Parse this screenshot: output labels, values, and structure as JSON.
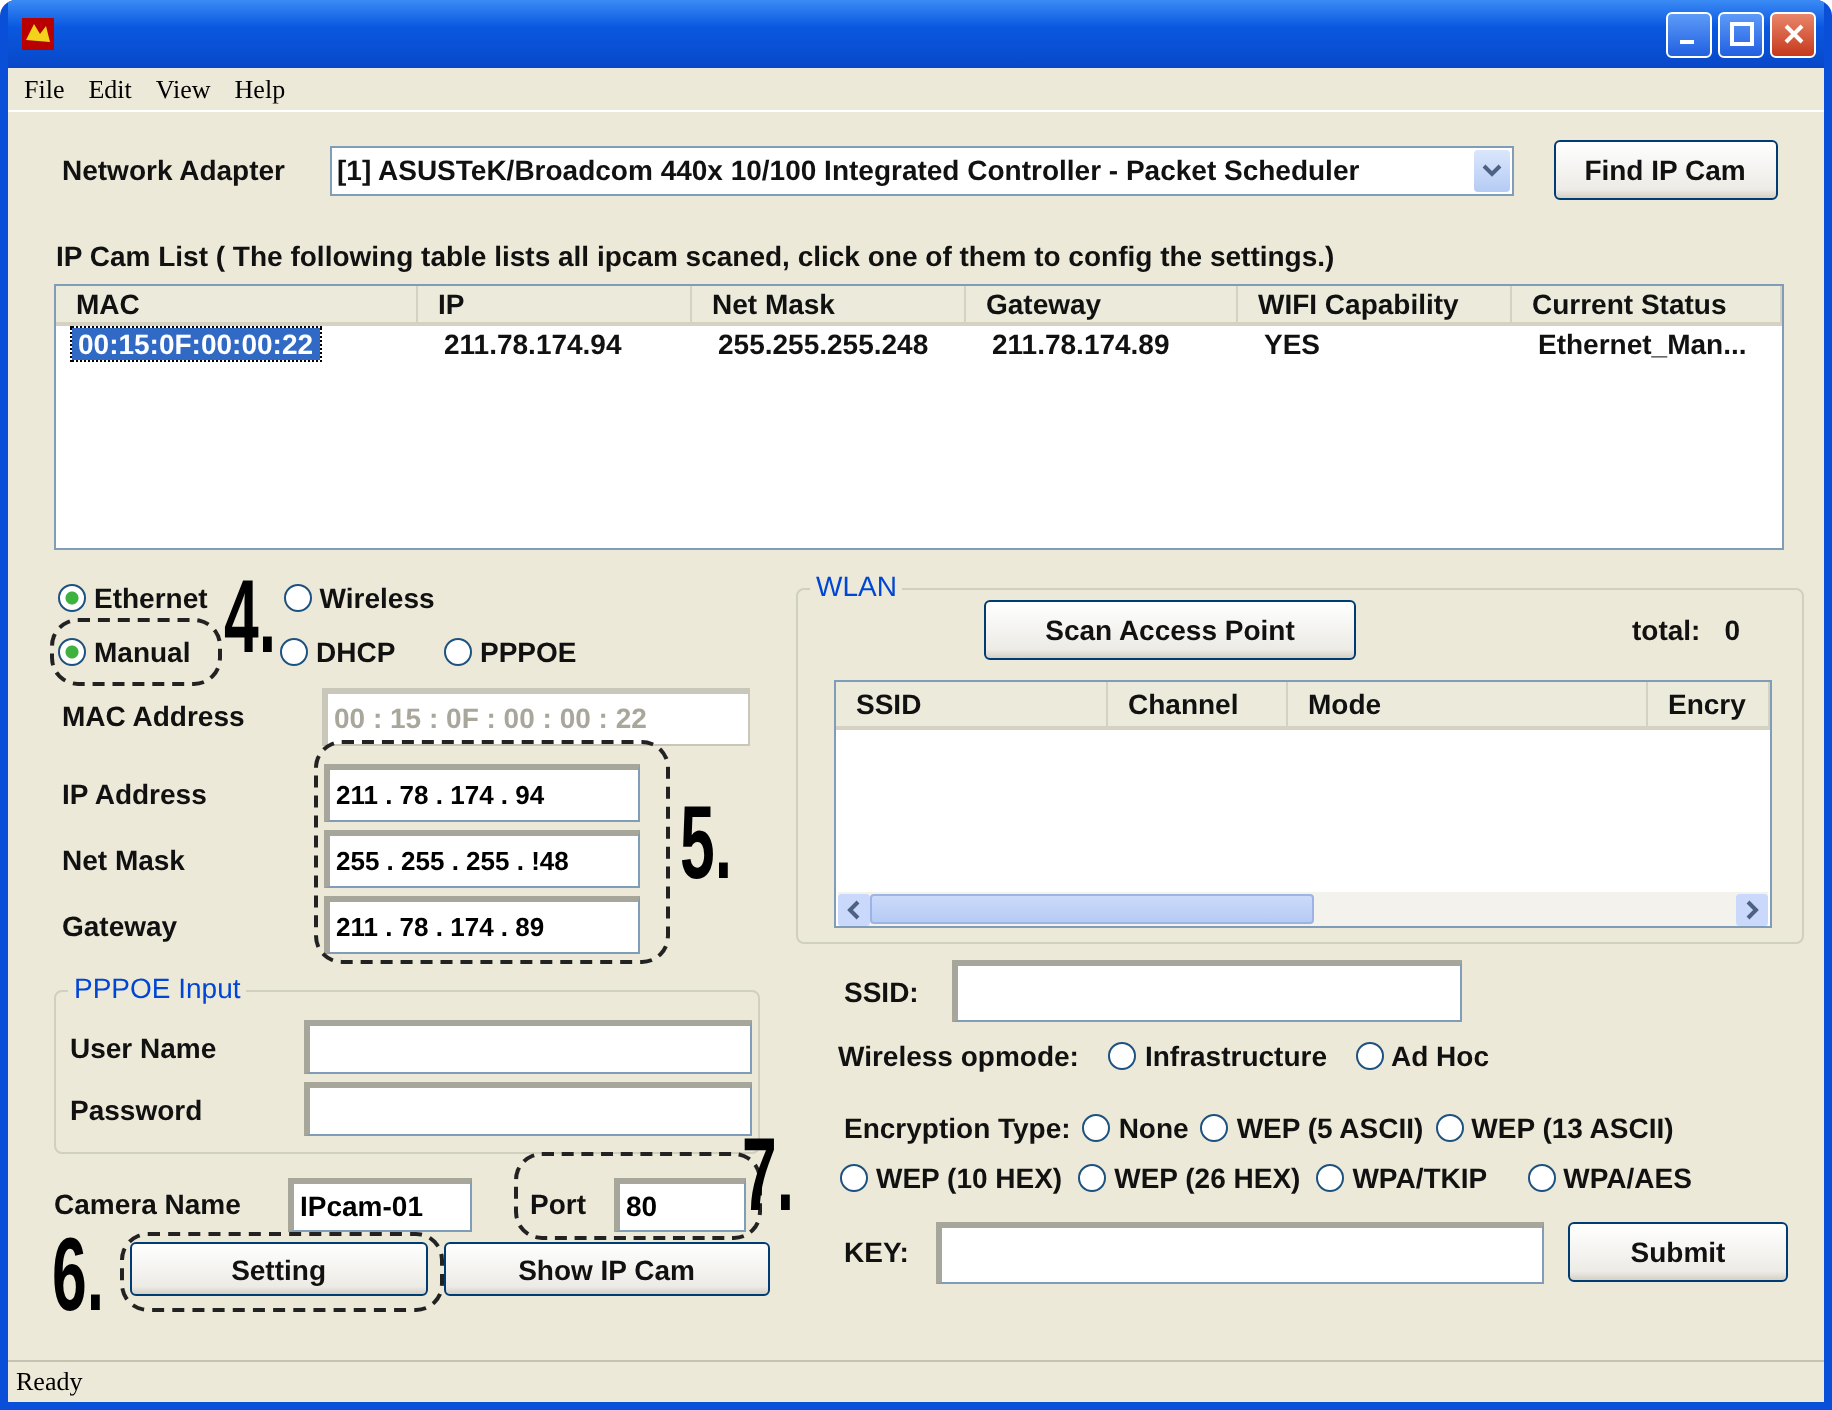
{
  "menu": [
    {
      "label": "File"
    },
    {
      "label": "Edit"
    },
    {
      "label": "View"
    },
    {
      "label": "Help"
    }
  ],
  "adapter": {
    "label": "Network Adapter",
    "value": "[1] ASUSTeK/Broadcom 440x 10/100 Integrated Controller - Packet Scheduler",
    "button": "Find IP Cam"
  },
  "ipcam_list": {
    "caption": "IP Cam List  ( The following table lists all ipcam scaned, click one of them to config the settings.)",
    "columns": [
      "MAC",
      "IP",
      "Net Mask",
      "Gateway",
      "WIFI Capability",
      "Current Status"
    ],
    "rows": [
      {
        "selected": true,
        "cells": [
          "00:15:0F:00:00:22",
          "211.78.174.94",
          "255.255.255.248",
          "211.78.174.89",
          "YES",
          "Ethernet_Man..."
        ]
      }
    ]
  },
  "connection": [
    {
      "label": "Ethernet",
      "selected": true
    },
    {
      "label": "Wireless",
      "selected": false
    }
  ],
  "ip_mode": [
    {
      "label": "Manual",
      "selected": true
    },
    {
      "label": "DHCP",
      "selected": false
    },
    {
      "label": "PPPOE",
      "selected": false
    }
  ],
  "address_fields": [
    {
      "label": "MAC Address",
      "value": "00 : 15 : 0F : 00 : 00 : 22",
      "disabled": true
    },
    {
      "label": "IP Address",
      "value": "211 . 78 . 174 . 94",
      "disabled": false
    },
    {
      "label": "Net Mask",
      "value": "255 . 255 . 255 . !48",
      "disabled": false
    },
    {
      "label": "Gateway",
      "value": "211 . 78 . 174 . 89",
      "disabled": false
    }
  ],
  "pppoe": {
    "title": "PPPOE Input",
    "fields": [
      {
        "label": "User Name"
      },
      {
        "label": "Password"
      }
    ]
  },
  "camera_name": {
    "label": "Camera Name",
    "value": "IPcam-01"
  },
  "port": {
    "label": "Port",
    "value": "80"
  },
  "buttons": [
    "Setting",
    "Show IP Cam"
  ],
  "wlan": {
    "title": "WLAN",
    "scan_button": "Scan Access Point",
    "total_label": "total:",
    "total": "0",
    "columns": [
      "SSID",
      "Channel",
      "Mode",
      "Encry"
    ]
  },
  "ssid": {
    "label": "SSID:"
  },
  "opmode": {
    "label": "Wireless opmode:",
    "options": [
      {
        "label": "Infrastructure",
        "selected": false
      },
      {
        "label": "Ad Hoc",
        "selected": false
      }
    ]
  },
  "encryption": {
    "label": "Encryption Type:",
    "options": [
      {
        "label": "None",
        "selected": false
      },
      {
        "label": "WEP (5 ASCII)",
        "selected": false
      },
      {
        "label": "WEP (13 ASCII)",
        "selected": false
      },
      {
        "label": "WEP (10 HEX)",
        "selected": false
      },
      {
        "label": "WEP (26 HEX)",
        "selected": false
      },
      {
        "label": "WPA/TKIP",
        "selected": false
      },
      {
        "label": "WPA/AES",
        "selected": false
      }
    ]
  },
  "key": {
    "label": "KEY:",
    "button": "Submit"
  },
  "status_bar": "Ready",
  "annotations": [
    {
      "text": "4."
    },
    {
      "text": "5."
    },
    {
      "text": "6."
    },
    {
      "text": "7."
    }
  ]
}
